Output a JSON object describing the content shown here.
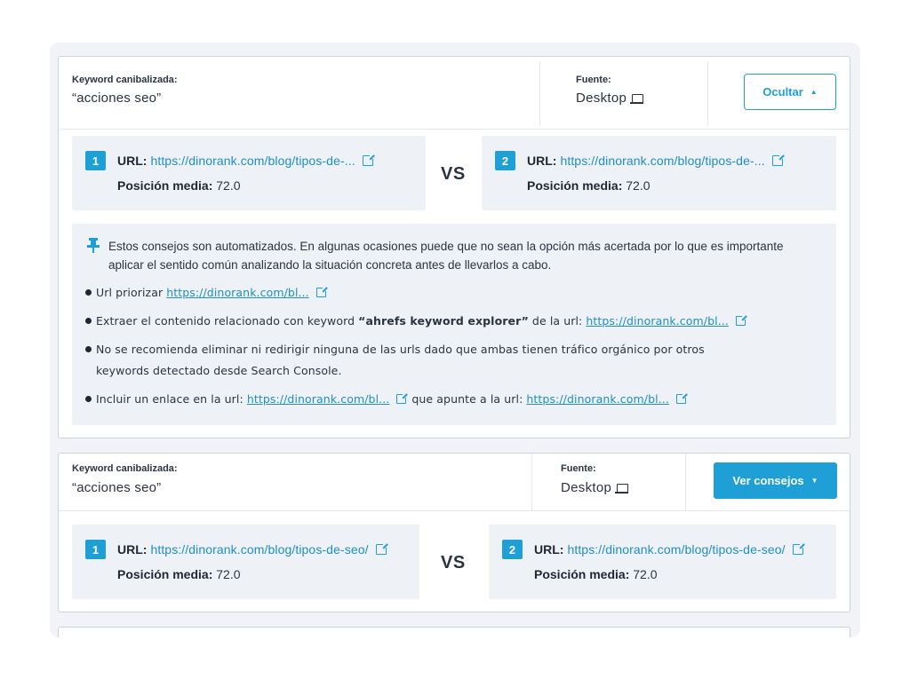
{
  "cards": [
    {
      "keyword_label": "Keyword canibalizada:",
      "keyword_value": "“acciones seo”",
      "source_label": "Fuente:",
      "source_value": "Desktop",
      "toggle_label": "Ocultar",
      "urls": [
        {
          "num": "1",
          "url_label": "URL:",
          "url": "https://dinorank.com/blog/tipos-de-...",
          "pos_label": "Posición media:",
          "pos_value": "72.0"
        },
        {
          "num": "2",
          "url_label": "URL:",
          "url": "https://dinorank.com/blog/tipos-de-...",
          "pos_label": "Posición media:",
          "pos_value": "72.0"
        }
      ],
      "vs": "VS",
      "advice": {
        "notice": "Estos consejos son automatizados. En algunas ocasiones puede que no sean la opción más acertada por lo que es importante aplicar el sentido común analizando la situación concreta antes de llevarlos a cabo.",
        "b1_text": "Url priorizar",
        "b1_link": "https://dinorank.com/bl...",
        "b2_text": "Extraer el contenido relacionado con keyword",
        "b2_keyword": "“ahrefs keyword explorer”",
        "b2_text2": "de la url:",
        "b2_link": "https://dinorank.com/bl...",
        "b3_line1": "No se recomienda eliminar ni redirigir ninguna de las urls dado  que ambas tienen tráfico orgánico por otros",
        "b3_line2": "keywords detectado desde Search Console.",
        "b4_text": "Incluir un enlace en la url:",
        "b4_link1": "https://dinorank.com/bl...",
        "b4_text2": "que apunte a la url:",
        "b4_link2": "https://dinorank.com/bl..."
      }
    },
    {
      "keyword_label": "Keyword canibalizada:",
      "keyword_value": "“acciones seo”",
      "source_label": "Fuente:",
      "source_value": "Desktop",
      "toggle_label": "Ver consejos",
      "urls": [
        {
          "num": "1",
          "url_label": "URL:",
          "url": "https://dinorank.com/blog/tipos-de-seo/",
          "pos_label": "Posición media:",
          "pos_value": "72.0"
        },
        {
          "num": "2",
          "url_label": "URL:",
          "url": "https://dinorank.com/blog/tipos-de-seo/",
          "pos_label": "Posición media:",
          "pos_value": "72.0"
        }
      ],
      "vs": "VS"
    }
  ],
  "colors": {
    "accent": "#1e9fd6",
    "panel": "#eef1f5",
    "border": "#c9d3de"
  }
}
